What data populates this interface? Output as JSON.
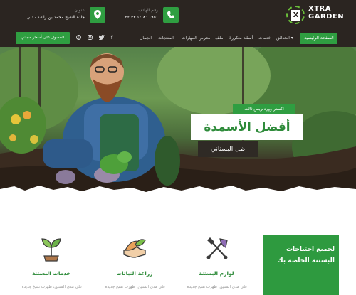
{
  "brand": {
    "name_line1": "XTRA",
    "name_line2": "GARDEN",
    "mark": "X"
  },
  "contacts": [
    {
      "label": "رقم الهاتف",
      "value": "٠٩٥١ ٨٦ ١٤ ٣٣ ٢٢",
      "icon": "phone-icon"
    },
    {
      "label": "عنوان",
      "value": "جادة الشيخ محمد بن راشد - دبي",
      "icon": "location-pin-icon"
    }
  ],
  "nav": {
    "home": "الصفحة الرئيسية",
    "items": [
      "الحدائق ▾",
      "خدمات",
      "أسئلة متكررة",
      "ملف",
      "معرض المهارات",
      "المنتجات",
      "الجمال"
    ],
    "cta": "الحصول على أسعار مجاني"
  },
  "hero": {
    "tag": "اكستر ووردبريس ثالث",
    "title": "أفضل الأسمدة",
    "subtitle": "ظل البستاني"
  },
  "services": [
    {
      "title": "لوازم البستنة",
      "desc": "على مدى السنين، ظهرت نسخ جديدة",
      "icon": "garden-tools-icon"
    },
    {
      "title": "زراعة النباتات",
      "desc": "على مدى السنين، ظهرت نسخ جديدة",
      "icon": "hand-plant-icon"
    },
    {
      "title": "خدمات البستنة",
      "desc": "على مدى السنين، ظهرت نسخ جديدة",
      "icon": "sprout-icon"
    }
  ],
  "promo": {
    "text": "لجميع احتياجات البستنة الخاصة بك"
  },
  "colors": {
    "accent": "#2f9e41",
    "dark": "#2b2521",
    "title_green": "#2e8b3a"
  }
}
